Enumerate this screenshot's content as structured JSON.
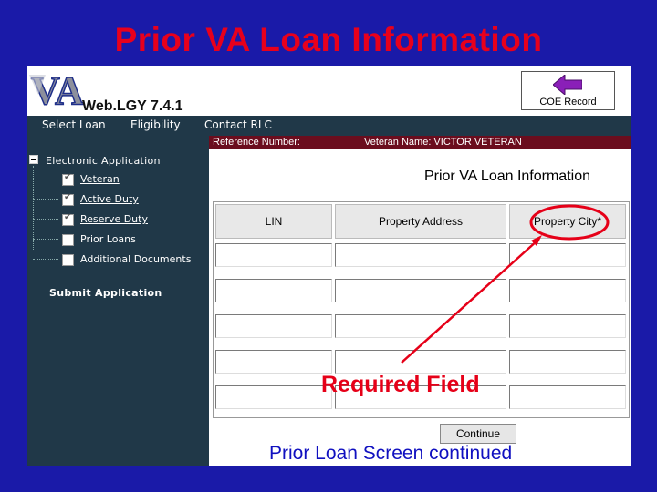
{
  "slide": {
    "title": "Prior VA Loan Information",
    "required_annotation": "Required Field",
    "caption": "Prior Loan Screen continued"
  },
  "app": {
    "logo_text": "VA",
    "name": "Web.LGY 7.4.1",
    "coe_record_label": "COE Record"
  },
  "nav": {
    "items": [
      "Select Loan",
      "Eligibility",
      "Contact RLC"
    ]
  },
  "sidebar": {
    "tree_title": "Electronic Application",
    "items": [
      {
        "label": "Veteran",
        "checked": true
      },
      {
        "label": "Active Duty",
        "checked": true
      },
      {
        "label": "Reserve Duty",
        "checked": true
      },
      {
        "label": "Prior Loans",
        "checked": false
      },
      {
        "label": "Additional Documents",
        "checked": false
      }
    ],
    "submit_label": "Submit Application"
  },
  "reference_bar": {
    "reference_label": "Reference Number:",
    "veteran_label": "Veteran Name: VICTOR VETERAN"
  },
  "form": {
    "title": "Prior VA Loan Information",
    "columns": [
      "LIN",
      "Property Address",
      "Property City*"
    ],
    "rows": [
      [
        "",
        "",
        ""
      ],
      [
        "",
        "",
        ""
      ],
      [
        "",
        "",
        ""
      ],
      [
        "",
        "",
        ""
      ],
      [
        "",
        "",
        ""
      ]
    ],
    "continue_label": "Continue"
  },
  "colors": {
    "slide_background": "#1a1aa8",
    "slide_title": "#e8001c",
    "nav_background": "#203848",
    "reference_bar": "#6b0d1e",
    "annotation": "#e60018",
    "caption_text": "#1010c0"
  }
}
